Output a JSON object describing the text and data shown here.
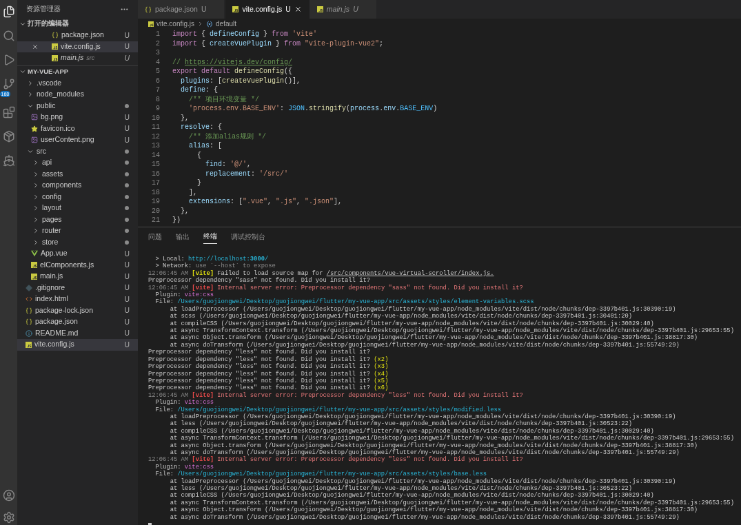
{
  "activity_bar": {
    "scm_badge": "168"
  },
  "sidebar": {
    "title": "资源管理器",
    "open_editors": {
      "title": "打开的编辑器",
      "expanded": true,
      "items": [
        {
          "name": "package.json",
          "kind": "json",
          "status": "U",
          "selected": false,
          "preview": false
        },
        {
          "name": "vite.config.js",
          "kind": "js",
          "status": "U",
          "selected": true,
          "preview": false
        },
        {
          "name": "main.js",
          "description": "src",
          "kind": "js",
          "status": "U",
          "selected": false,
          "preview": true
        }
      ]
    },
    "project": {
      "title": "MY-VUE-APP",
      "expanded": true,
      "tree": [
        {
          "name": ".vscode",
          "kind": "folder",
          "expanded": false,
          "changed": false,
          "selected": false
        },
        {
          "name": "node_modules",
          "kind": "folder",
          "expanded": false,
          "changed": false,
          "selected": false
        },
        {
          "name": "public",
          "kind": "folder",
          "expanded": true,
          "changed": true,
          "selected": false,
          "children": [
            {
              "name": "bg.png",
              "kind": "image",
              "status": "U",
              "selected": false
            },
            {
              "name": "favicon.ico",
              "kind": "star",
              "status": "U",
              "selected": false
            },
            {
              "name": "userContent.png",
              "kind": "image",
              "status": "U",
              "selected": false
            }
          ]
        },
        {
          "name": "src",
          "kind": "folder",
          "expanded": true,
          "changed": true,
          "selected": false,
          "children": [
            {
              "name": "api",
              "kind": "folder",
              "expanded": false,
              "changed": true,
              "selected": false
            },
            {
              "name": "assets",
              "kind": "folder",
              "expanded": false,
              "changed": true,
              "selected": false
            },
            {
              "name": "components",
              "kind": "folder",
              "expanded": false,
              "changed": true,
              "selected": false
            },
            {
              "name": "config",
              "kind": "folder",
              "expanded": false,
              "changed": true,
              "selected": false
            },
            {
              "name": "layout",
              "kind": "folder",
              "expanded": false,
              "changed": true,
              "selected": false
            },
            {
              "name": "pages",
              "kind": "folder",
              "expanded": false,
              "changed": true,
              "selected": false
            },
            {
              "name": "router",
              "kind": "folder",
              "expanded": false,
              "changed": true,
              "selected": false
            },
            {
              "name": "store",
              "kind": "folder",
              "expanded": false,
              "changed": true,
              "selected": false
            },
            {
              "name": "App.vue",
              "kind": "vue",
              "status": "U",
              "selected": false
            },
            {
              "name": "elComponents.js",
              "kind": "js",
              "status": "U",
              "selected": false
            },
            {
              "name": "main.js",
              "kind": "js",
              "status": "U",
              "selected": false
            }
          ]
        },
        {
          "name": ".gitignore",
          "kind": "git",
          "status": "U",
          "selected": false
        },
        {
          "name": "index.html",
          "kind": "html",
          "status": "U",
          "selected": false
        },
        {
          "name": "package-lock.json",
          "kind": "json",
          "status": "U",
          "selected": false
        },
        {
          "name": "package.json",
          "kind": "json",
          "status": "U",
          "selected": false
        },
        {
          "name": "README.md",
          "kind": "info",
          "status": "U",
          "selected": false
        },
        {
          "name": "vite.config.js",
          "kind": "js",
          "status": "U",
          "selected": true
        }
      ]
    }
  },
  "tabs": [
    {
      "label": "package.json",
      "kind": "json",
      "status": "U",
      "selected": false,
      "preview": false
    },
    {
      "label": "vite.config.js",
      "kind": "js",
      "status": "U",
      "selected": true,
      "preview": false
    },
    {
      "label": "main.js",
      "kind": "js",
      "status": "U",
      "selected": false,
      "preview": true
    }
  ],
  "breadcrumb": {
    "file": "vite.config.js",
    "symbol": "default"
  },
  "code_lines": [
    {
      "number": "1",
      "segments": [
        {
          "kind": "keyword",
          "text": "import"
        },
        {
          "kind": "plain",
          "text": " { "
        },
        {
          "kind": "variable",
          "text": "defineConfig"
        },
        {
          "kind": "plain",
          "text": " } "
        },
        {
          "kind": "keyword",
          "text": "from"
        },
        {
          "kind": "string",
          "text": " 'vite'"
        }
      ]
    },
    {
      "number": "2",
      "segments": [
        {
          "kind": "keyword",
          "text": "import"
        },
        {
          "kind": "plain",
          "text": " { "
        },
        {
          "kind": "variable",
          "text": "createVuePlugin"
        },
        {
          "kind": "plain",
          "text": " } "
        },
        {
          "kind": "keyword",
          "text": "from"
        },
        {
          "kind": "string",
          "text": " \"vite-plugin-vue2\""
        },
        {
          "kind": "plain",
          "text": ";"
        }
      ]
    },
    {
      "number": "3"
    },
    {
      "number": "4",
      "segments": [
        {
          "kind": "comment",
          "text": "// "
        },
        {
          "kind": "link",
          "text": "https://vitejs.dev/config/"
        }
      ]
    },
    {
      "number": "5",
      "segments": [
        {
          "kind": "keyword",
          "text": "export default "
        },
        {
          "kind": "function",
          "text": "defineConfig"
        },
        {
          "kind": "plain",
          "text": "({"
        }
      ]
    },
    {
      "number": "6",
      "segments": [
        {
          "kind": "variable",
          "text": "  plugins"
        },
        {
          "kind": "plain",
          "text": ": ["
        },
        {
          "kind": "function",
          "text": "createVuePlugin"
        },
        {
          "kind": "plain",
          "text": "()],"
        }
      ]
    },
    {
      "number": "7",
      "segments": [
        {
          "kind": "variable",
          "text": "  define"
        },
        {
          "kind": "plain",
          "text": ": {"
        }
      ]
    },
    {
      "number": "8",
      "segments": [
        {
          "kind": "comment",
          "text": "    /** 项目环境变量 */"
        }
      ]
    },
    {
      "number": "9",
      "segments": [
        {
          "kind": "string",
          "text": "    'process.env.BASE_ENV'"
        },
        {
          "kind": "plain",
          "text": ": "
        },
        {
          "kind": "constant",
          "text": "JSON"
        },
        {
          "kind": "plain",
          "text": "."
        },
        {
          "kind": "function",
          "text": "stringify"
        },
        {
          "kind": "plain",
          "text": "("
        },
        {
          "kind": "variable",
          "text": "process"
        },
        {
          "kind": "plain",
          "text": "."
        },
        {
          "kind": "variable",
          "text": "env"
        },
        {
          "kind": "plain",
          "text": "."
        },
        {
          "kind": "constant",
          "text": "BASE_ENV"
        },
        {
          "kind": "plain",
          "text": ")"
        }
      ]
    },
    {
      "number": "10",
      "segments": [
        {
          "kind": "plain",
          "text": "  },"
        }
      ]
    },
    {
      "number": "11",
      "segments": [
        {
          "kind": "variable",
          "text": "  resolve"
        },
        {
          "kind": "plain",
          "text": ": {"
        }
      ]
    },
    {
      "number": "12",
      "segments": [
        {
          "kind": "comment",
          "text": "    /** 添加alias规则 */"
        }
      ]
    },
    {
      "number": "13",
      "segments": [
        {
          "kind": "variable",
          "text": "    alias"
        },
        {
          "kind": "plain",
          "text": ": ["
        }
      ]
    },
    {
      "number": "14",
      "segments": [
        {
          "kind": "plain",
          "text": "      {"
        }
      ]
    },
    {
      "number": "15",
      "segments": [
        {
          "kind": "variable",
          "text": "        find"
        },
        {
          "kind": "plain",
          "text": ": "
        },
        {
          "kind": "string",
          "text": "'@/'"
        },
        {
          "kind": "plain",
          "text": ","
        }
      ]
    },
    {
      "number": "16",
      "segments": [
        {
          "kind": "variable",
          "text": "        replacement"
        },
        {
          "kind": "plain",
          "text": ": "
        },
        {
          "kind": "string",
          "text": "'/src/'"
        }
      ]
    },
    {
      "number": "17",
      "segments": [
        {
          "kind": "plain",
          "text": "      }"
        }
      ]
    },
    {
      "number": "18",
      "segments": [
        {
          "kind": "plain",
          "text": "    ],"
        }
      ]
    },
    {
      "number": "19",
      "segments": [
        {
          "kind": "variable",
          "text": "    extensions"
        },
        {
          "kind": "plain",
          "text": ": ["
        },
        {
          "kind": "string",
          "text": "\".vue\""
        },
        {
          "kind": "plain",
          "text": ", "
        },
        {
          "kind": "string",
          "text": "\".js\""
        },
        {
          "kind": "plain",
          "text": ", "
        },
        {
          "kind": "string",
          "text": "\".json\""
        },
        {
          "kind": "plain",
          "text": "],"
        }
      ]
    },
    {
      "number": "20",
      "segments": [
        {
          "kind": "plain",
          "text": "  },"
        }
      ]
    },
    {
      "number": "21",
      "segments": [
        {
          "kind": "plain",
          "text": "})"
        }
      ]
    }
  ],
  "panel_tabs": [
    {
      "label": "问题",
      "selected": false
    },
    {
      "label": "输出",
      "selected": false
    },
    {
      "label": "终端",
      "selected": true
    },
    {
      "label": "调试控制台",
      "selected": false
    }
  ],
  "terminal_lines": [
    {
      "segments": [
        {
          "kind": "plain",
          "text": "  > Local: "
        },
        {
          "kind": "url",
          "text": "http://localhost:**3000**/"
        }
      ]
    },
    {
      "segments": [
        {
          "kind": "plain",
          "text": "  > Network: "
        },
        {
          "kind": "dim",
          "text": "use `--host` to expose"
        }
      ]
    },
    {
      "segments": [
        {
          "kind": "dim",
          "text": "12:06:45 AM "
        },
        {
          "kind": "tag_warn",
          "text": "[vite]"
        },
        {
          "kind": "plain",
          "text": " Failed to load source map for "
        },
        {
          "kind": "underline",
          "text": "/src/components/vue-virtual-scroller/index.js."
        }
      ]
    },
    {
      "segments": [
        {
          "kind": "plain",
          "text": "Preprocessor dependency \"sass\" not found. Did you install it?"
        }
      ]
    },
    {
      "segments": [
        {
          "kind": "dim",
          "text": "12:06:45 AM "
        },
        {
          "kind": "tag_error",
          "text": "[vite]"
        },
        {
          "kind": "error",
          "text": " Internal server error: Preprocessor dependency \"sass\" not found. Did you install it?"
        }
      ]
    },
    {
      "segments": [
        {
          "kind": "plain",
          "text": "  Plugin: "
        },
        {
          "kind": "plugin",
          "text": "vite:css"
        }
      ]
    },
    {
      "segments": [
        {
          "kind": "plain",
          "text": "  File: "
        },
        {
          "kind": "path",
          "text": "/Users/guojiongwei/Desktop/guojiongwei/flutter/my-vue-app/src/assets/styles/element-variables.scss"
        }
      ]
    },
    {
      "segments": [
        {
          "kind": "plain",
          "text": "      at loadPreprocessor (/Users/guojiongwei/Desktop/guojiongwei/flutter/my-vue-app/node_modules/vite/dist/node/chunks/dep-3397b401.js:30390:19)"
        }
      ]
    },
    {
      "segments": [
        {
          "kind": "plain",
          "text": "      at scss (/Users/guojiongwei/Desktop/guojiongwei/flutter/my-vue-app/node_modules/vite/dist/node/chunks/dep-3397b401.js:30401:20)"
        }
      ]
    },
    {
      "segments": [
        {
          "kind": "plain",
          "text": "      at compileCSS (/Users/guojiongwei/Desktop/guojiongwei/flutter/my-vue-app/node_modules/vite/dist/node/chunks/dep-3397b401.js:30029:40)"
        }
      ]
    },
    {
      "segments": [
        {
          "kind": "plain",
          "text": "      at async TransformContext.transform (/Users/guojiongwei/Desktop/guojiongwei/flutter/my-vue-app/node_modules/vite/dist/node/chunks/dep-3397b401.js:29653:55)"
        }
      ]
    },
    {
      "segments": [
        {
          "kind": "plain",
          "text": "      at async Object.transform (/Users/guojiongwei/Desktop/guojiongwei/flutter/my-vue-app/node_modules/vite/dist/node/chunks/dep-3397b401.js:38817:30)"
        }
      ]
    },
    {
      "segments": [
        {
          "kind": "plain",
          "text": "      at async doTransform (/Users/guojiongwei/Desktop/guojiongwei/flutter/my-vue-app/node_modules/vite/dist/node/chunks/dep-3397b401.js:55749:29)"
        }
      ]
    },
    {
      "segments": [
        {
          "kind": "plain",
          "text": "Preprocessor dependency \"less\" not found. Did you install it?"
        }
      ]
    },
    {
      "segments": [
        {
          "kind": "plain",
          "text": "Preprocessor dependency \"less\" not found. Did you install it? "
        },
        {
          "kind": "count",
          "text": "(x2)"
        }
      ]
    },
    {
      "segments": [
        {
          "kind": "plain",
          "text": "Preprocessor dependency \"less\" not found. Did you install it? "
        },
        {
          "kind": "count",
          "text": "(x3)"
        }
      ]
    },
    {
      "segments": [
        {
          "kind": "plain",
          "text": "Preprocessor dependency \"less\" not found. Did you install it? "
        },
        {
          "kind": "count",
          "text": "(x4)"
        }
      ]
    },
    {
      "segments": [
        {
          "kind": "plain",
          "text": "Preprocessor dependency \"less\" not found. Did you install it? "
        },
        {
          "kind": "count",
          "text": "(x5)"
        }
      ]
    },
    {
      "segments": [
        {
          "kind": "plain",
          "text": "Preprocessor dependency \"less\" not found. Did you install it? "
        },
        {
          "kind": "count",
          "text": "(x6)"
        }
      ]
    },
    {
      "segments": [
        {
          "kind": "dim",
          "text": "12:06:45 AM "
        },
        {
          "kind": "tag_error",
          "text": "[vite]"
        },
        {
          "kind": "error",
          "text": " Internal server error: Preprocessor dependency \"less\" not found. Did you install it?"
        }
      ]
    },
    {
      "segments": [
        {
          "kind": "plain",
          "text": "  Plugin: "
        },
        {
          "kind": "plugin",
          "text": "vite:css"
        }
      ]
    },
    {
      "segments": [
        {
          "kind": "plain",
          "text": "  File: "
        },
        {
          "kind": "path",
          "text": "/Users/guojiongwei/Desktop/guojiongwei/flutter/my-vue-app/src/assets/styles/modified.less"
        }
      ]
    },
    {
      "segments": [
        {
          "kind": "plain",
          "text": "      at loadPreprocessor (/Users/guojiongwei/Desktop/guojiongwei/flutter/my-vue-app/node_modules/vite/dist/node/chunks/dep-3397b401.js:30390:19)"
        }
      ]
    },
    {
      "segments": [
        {
          "kind": "plain",
          "text": "      at less (/Users/guojiongwei/Desktop/guojiongwei/flutter/my-vue-app/node_modules/vite/dist/node/chunks/dep-3397b401.js:30523:22)"
        }
      ]
    },
    {
      "segments": [
        {
          "kind": "plain",
          "text": "      at compileCSS (/Users/guojiongwei/Desktop/guojiongwei/flutter/my-vue-app/node_modules/vite/dist/node/chunks/dep-3397b401.js:30029:40)"
        }
      ]
    },
    {
      "segments": [
        {
          "kind": "plain",
          "text": "      at async TransformContext.transform (/Users/guojiongwei/Desktop/guojiongwei/flutter/my-vue-app/node_modules/vite/dist/node/chunks/dep-3397b401.js:29653:55)"
        }
      ]
    },
    {
      "segments": [
        {
          "kind": "plain",
          "text": "      at async Object.transform (/Users/guojiongwei/Desktop/guojiongwei/flutter/my-vue-app/node_modules/vite/dist/node/chunks/dep-3397b401.js:38817:30)"
        }
      ]
    },
    {
      "segments": [
        {
          "kind": "plain",
          "text": "      at async doTransform (/Users/guojiongwei/Desktop/guojiongwei/flutter/my-vue-app/node_modules/vite/dist/node/chunks/dep-3397b401.js:55749:29)"
        }
      ]
    },
    {
      "segments": [
        {
          "kind": "dim",
          "text": "12:06:45 AM "
        },
        {
          "kind": "tag_error",
          "text": "[vite]"
        },
        {
          "kind": "error",
          "text": " Internal server error: Preprocessor dependency \"less\" not found. Did you install it?"
        }
      ]
    },
    {
      "segments": [
        {
          "kind": "plain",
          "text": "  Plugin: "
        },
        {
          "kind": "plugin",
          "text": "vite:css"
        }
      ]
    },
    {
      "segments": [
        {
          "kind": "plain",
          "text": "  File: "
        },
        {
          "kind": "path",
          "text": "/Users/guojiongwei/Desktop/guojiongwei/flutter/my-vue-app/src/assets/styles/base.less"
        }
      ]
    },
    {
      "segments": [
        {
          "kind": "plain",
          "text": "      at loadPreprocessor (/Users/guojiongwei/Desktop/guojiongwei/flutter/my-vue-app/node_modules/vite/dist/node/chunks/dep-3397b401.js:30390:19)"
        }
      ]
    },
    {
      "segments": [
        {
          "kind": "plain",
          "text": "      at less (/Users/guojiongwei/Desktop/guojiongwei/flutter/my-vue-app/node_modules/vite/dist/node/chunks/dep-3397b401.js:30523:22)"
        }
      ]
    },
    {
      "segments": [
        {
          "kind": "plain",
          "text": "      at compileCSS (/Users/guojiongwei/Desktop/guojiongwei/flutter/my-vue-app/node_modules/vite/dist/node/chunks/dep-3397b401.js:30029:40)"
        }
      ]
    },
    {
      "segments": [
        {
          "kind": "plain",
          "text": "      at async TransformContext.transform (/Users/guojiongwei/Desktop/guojiongwei/flutter/my-vue-app/node_modules/vite/dist/node/chunks/dep-3397b401.js:29653:55)"
        }
      ]
    },
    {
      "segments": [
        {
          "kind": "plain",
          "text": "      at async Object.transform (/Users/guojiongwei/Desktop/guojiongwei/flutter/my-vue-app/node_modules/vite/dist/node/chunks/dep-3397b401.js:38817:30)"
        }
      ]
    },
    {
      "segments": [
        {
          "kind": "plain",
          "text": "      at async doTransform (/Users/guojiongwei/Desktop/guojiongwei/flutter/my-vue-app/node_modules/vite/dist/node/chunks/dep-3397b401.js:55749:29)"
        }
      ]
    }
  ]
}
